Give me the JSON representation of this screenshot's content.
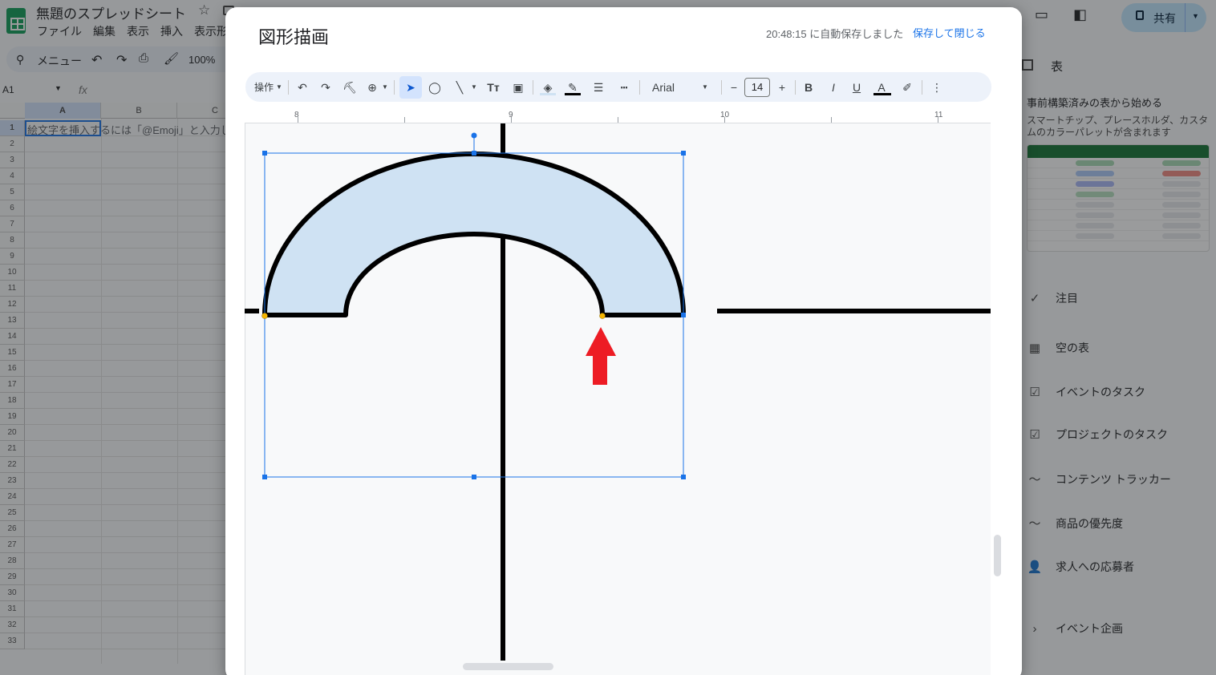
{
  "sheet": {
    "doc_title": "無題のスプレッドシート",
    "menus": [
      "ファイル",
      "編集",
      "表示",
      "挿入",
      "表示形"
    ],
    "toolbar": {
      "menu_label": "メニュー",
      "zoom": "100%"
    },
    "name_box": "A1",
    "fx": "fx",
    "columns": [
      "A",
      "B",
      "C"
    ],
    "rows": [
      "1",
      "2",
      "3",
      "4",
      "5",
      "6",
      "7",
      "8",
      "9",
      "10",
      "11",
      "12",
      "13",
      "14",
      "15",
      "16",
      "17",
      "18",
      "19",
      "20",
      "21",
      "22",
      "23",
      "24",
      "25",
      "26",
      "27",
      "28",
      "29",
      "30",
      "31",
      "32",
      "33"
    ],
    "cell_a1": "絵文字を挿入するには「@Emoji」と入力しま"
  },
  "share": {
    "label": "共有"
  },
  "sidebar": {
    "title": "表",
    "heading": "事前構築済みの表から始める",
    "description": "スマートチップ、プレースホルダ、カスタムのカラーパレットが含まれます",
    "items": [
      {
        "label": "注目",
        "icon": "check-icon"
      },
      {
        "label": "空の表",
        "icon": "table-icon"
      },
      {
        "label": "イベントのタスク",
        "icon": "checklist-icon"
      },
      {
        "label": "プロジェクトのタスク",
        "icon": "checklist-icon"
      },
      {
        "label": "コンテンツ トラッカー",
        "icon": "trend-icon"
      },
      {
        "label": "商品の優先度",
        "icon": "trend-icon"
      },
      {
        "label": "求人への応募者",
        "icon": "person-icon"
      },
      {
        "label": "イベント企画",
        "icon": "chevron-right-icon"
      }
    ]
  },
  "dialog": {
    "title": "図形描画",
    "autosave": "20:48:15 に自動保存しました",
    "save_close": "保存して閉じる",
    "toolbar": {
      "actions": "操作",
      "font": "Arial",
      "font_size": "14",
      "bold": "B",
      "italic": "I",
      "underline": "U",
      "text_color": "A",
      "text_tool": "Tт"
    },
    "ruler_labels": [
      "8",
      "9",
      "10",
      "11"
    ],
    "colors": {
      "shape_fill": "#cfe2f3",
      "stroke": "#000000",
      "selection": "#1a73e8",
      "arrow": "#ed1c24",
      "handle_yellow": "#f4b400"
    }
  }
}
